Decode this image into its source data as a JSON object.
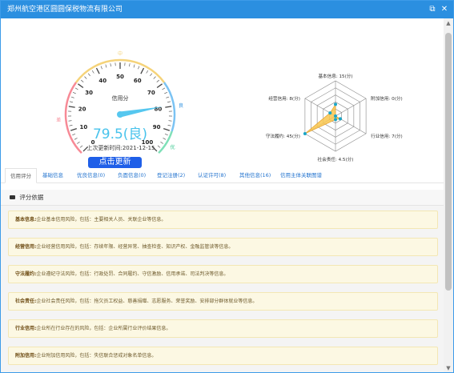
{
  "window": {
    "title": "郑州航空港区圆圆保税物流有限公司",
    "restore_icon": "⧉",
    "close_icon": "✕"
  },
  "gauge": {
    "label": "信用分",
    "score_text": "79.5(良)",
    "score": 79.5,
    "ticks": [
      "0",
      "10",
      "20",
      "30",
      "40",
      "50",
      "60",
      "70",
      "80",
      "90",
      "100"
    ],
    "band_labels": {
      "low": "差",
      "mid": "中",
      "good": "良",
      "best": "优"
    },
    "band_colors": [
      "#f78a96",
      "#f5d37a",
      "#7bc3f3",
      "#7fe0b8"
    ],
    "needle_color": "#56c7ef"
  },
  "last_update": "上次更新时间:2021-12-15",
  "refresh_button": "点击更新",
  "radar": {
    "axes": [
      {
        "label": "基本信息: 15(分)",
        "value": 15
      },
      {
        "label": "附加信用: 0(分)",
        "value": 0
      },
      {
        "label": "行业信用: 7(分)",
        "value": 7
      },
      {
        "label": "社会责任: 4.5(分)",
        "value": 4.5
      },
      {
        "label": "守法履约: 45(分)",
        "value": 45
      },
      {
        "label": "经营信用: 8(分)",
        "value": 8
      }
    ],
    "fill_color": "#f9c74f",
    "point_color": "#1aa6c7"
  },
  "tabs": [
    {
      "label": "信用评分",
      "active": true
    },
    {
      "label": "基础信息",
      "active": false
    },
    {
      "label": "优良信息(0)",
      "active": false
    },
    {
      "label": "负面信息(0)",
      "active": false
    },
    {
      "label": "登记注册(2)",
      "active": false
    },
    {
      "label": "认证许可(8)",
      "active": false
    },
    {
      "label": "其他信息(16)",
      "active": false
    },
    {
      "label": "信用主体关联图谱",
      "active": false
    }
  ],
  "basis": {
    "heading": "评分依据",
    "items": [
      {
        "title": "基本信息:",
        "text": "企业基本信用风险，包括：主要相关人员、关联企业等信息。"
      },
      {
        "title": "经营信用:",
        "text": "企业经营信用风险，包括：存续年限、经营异常、抽查检查、知识产权、金融监管读等信息。"
      },
      {
        "title": "守法履约:",
        "text": "企业遵纪守法风险，包括：行政处罚、合同履约、守信激励、信用承诺、司法判决等信息。"
      },
      {
        "title": "社会责任:",
        "text": "企业社会责任风险，包括：拖欠员工权益、慈善捐赠、志愿服务、荣誉奖励、安排部分群体就业等信息。"
      },
      {
        "title": "行业信用:",
        "text": "企业所在行业存在的风险，包括：企业所属行业评价结果信息。"
      },
      {
        "title": "附加信用:",
        "text": "企业附加信用风险，包括：失信联合惩戒对象名单信息。"
      }
    ]
  }
}
